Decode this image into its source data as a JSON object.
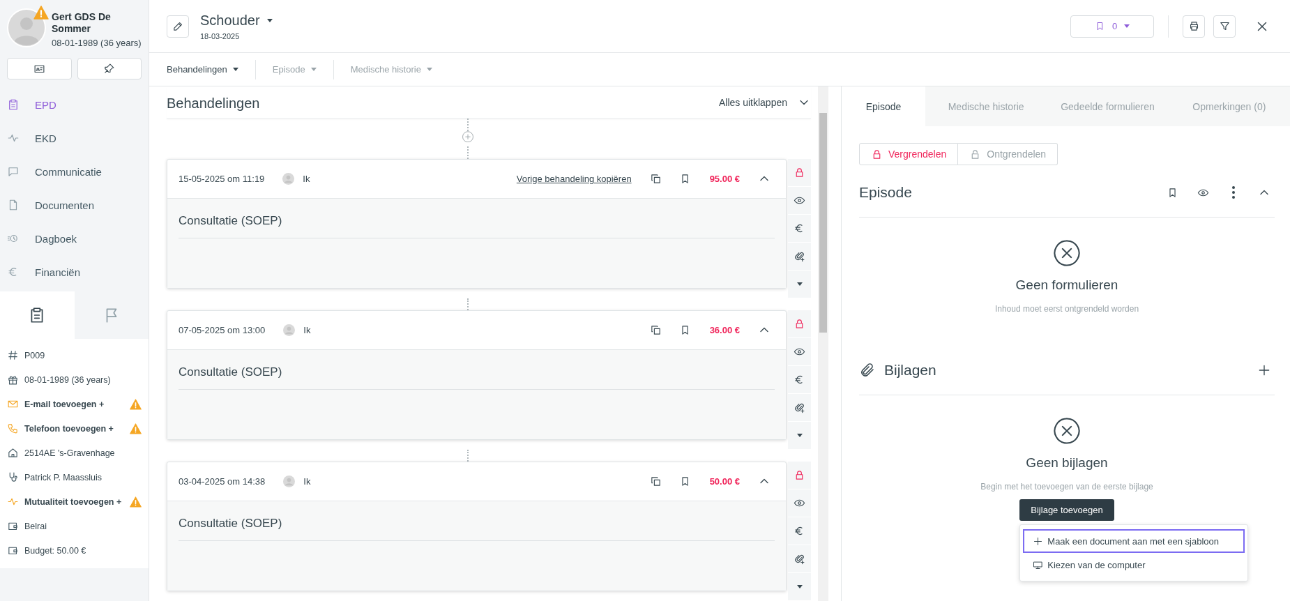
{
  "patient": {
    "name": "Gert GDS De Sommer",
    "birth": "08-01-1989 (36 years)",
    "warning": true
  },
  "sidebar": {
    "nav": [
      {
        "label": "EPD",
        "selected": true
      },
      {
        "label": "EKD",
        "selected": false
      },
      {
        "label": "Communicatie",
        "selected": false
      },
      {
        "label": "Documenten",
        "selected": false
      },
      {
        "label": "Dagboek",
        "selected": false
      },
      {
        "label": "Financiën",
        "selected": false
      }
    ],
    "tabs": [
      {
        "selected": true
      },
      {
        "selected": false
      }
    ],
    "info": [
      {
        "label": "P009",
        "kind": "plain"
      },
      {
        "label": "08-01-1989 (36 years)",
        "kind": "plain"
      },
      {
        "label": "E-mail toevoegen +",
        "kind": "missing"
      },
      {
        "label": "Telefoon toevoegen +",
        "kind": "missing"
      },
      {
        "label": "2514AE 's-Gravenhage",
        "kind": "plain"
      },
      {
        "label": "Patrick P. Maassluis",
        "kind": "plain"
      },
      {
        "label": "Mutualiteit toevoegen +",
        "kind": "missing"
      },
      {
        "label": "Belrai",
        "kind": "plain"
      },
      {
        "label": "Budget: 50.00 €",
        "kind": "plain"
      }
    ]
  },
  "header": {
    "title": "Schouder",
    "date": "18-03-2025",
    "bookmarks": "0"
  },
  "subnav": [
    {
      "label": "Behandelingen",
      "selected": true
    },
    {
      "label": "Episode",
      "selected": false
    },
    {
      "label": "Medische historie",
      "selected": false
    }
  ],
  "treatments": {
    "title": "Behandelingen",
    "expand_all": "Alles uitklappen",
    "cards": [
      {
        "date": "15-05-2025 om 11:19",
        "user": "Ik",
        "copy_link": "Vorige behandeling kopiëren",
        "price": "95.00 €",
        "expanded": true,
        "locked": true,
        "form": "Consultatie (SOEP)"
      },
      {
        "date": "07-05-2025 om 13:00",
        "user": "Ik",
        "price": "36.00 €",
        "expanded": true,
        "locked": true,
        "form": "Consultatie (SOEP)"
      },
      {
        "date": "03-04-2025 om 14:38",
        "user": "Ik",
        "price": "50.00 €",
        "expanded": true,
        "locked": true,
        "form": "Consultatie (SOEP)"
      }
    ]
  },
  "panel": {
    "tabs": [
      {
        "label": "Episode",
        "selected": true
      },
      {
        "label": "Medische historie",
        "selected": false
      },
      {
        "label": "Gedeelde formulieren",
        "selected": false
      },
      {
        "label": "Opmerkingen (0)",
        "selected": false
      }
    ],
    "lock_buttons": [
      {
        "label": "Vergrendelen",
        "selected": true
      },
      {
        "label": "Ontgrendelen",
        "selected": false
      }
    ],
    "episode": {
      "title": "Episode",
      "empty_title": "Geen formulieren",
      "empty_text": "Inhoud moet eerst ontgrendeld worden"
    },
    "attachments": {
      "title": "Bijlagen",
      "empty_title": "Geen bijlagen",
      "empty_text": "Begin met het toevoegen van de eerste bijlage",
      "add_button": "Bijlage toevoegen",
      "menu": [
        {
          "label": "Maak een document aan met een sjabloon",
          "selected": true
        },
        {
          "label": "Kiezen van de computer",
          "selected": false
        }
      ]
    }
  }
}
